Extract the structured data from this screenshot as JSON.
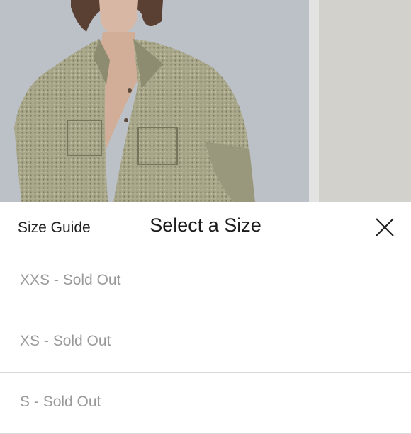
{
  "header": {
    "size_guide_label": "Size Guide",
    "title": "Select a Size",
    "close_icon": "close-icon"
  },
  "sizes": [
    {
      "size": "XXS",
      "separator": " - ",
      "status": "Sold Out"
    },
    {
      "size": "XS",
      "separator": " - ",
      "status": "Sold Out"
    },
    {
      "size": "S",
      "separator": " - ",
      "status": "Sold Out"
    }
  ],
  "colors": {
    "text_primary": "#1c1c1c",
    "text_disabled": "#9a9a9a",
    "divider": "#c8c8c8"
  }
}
